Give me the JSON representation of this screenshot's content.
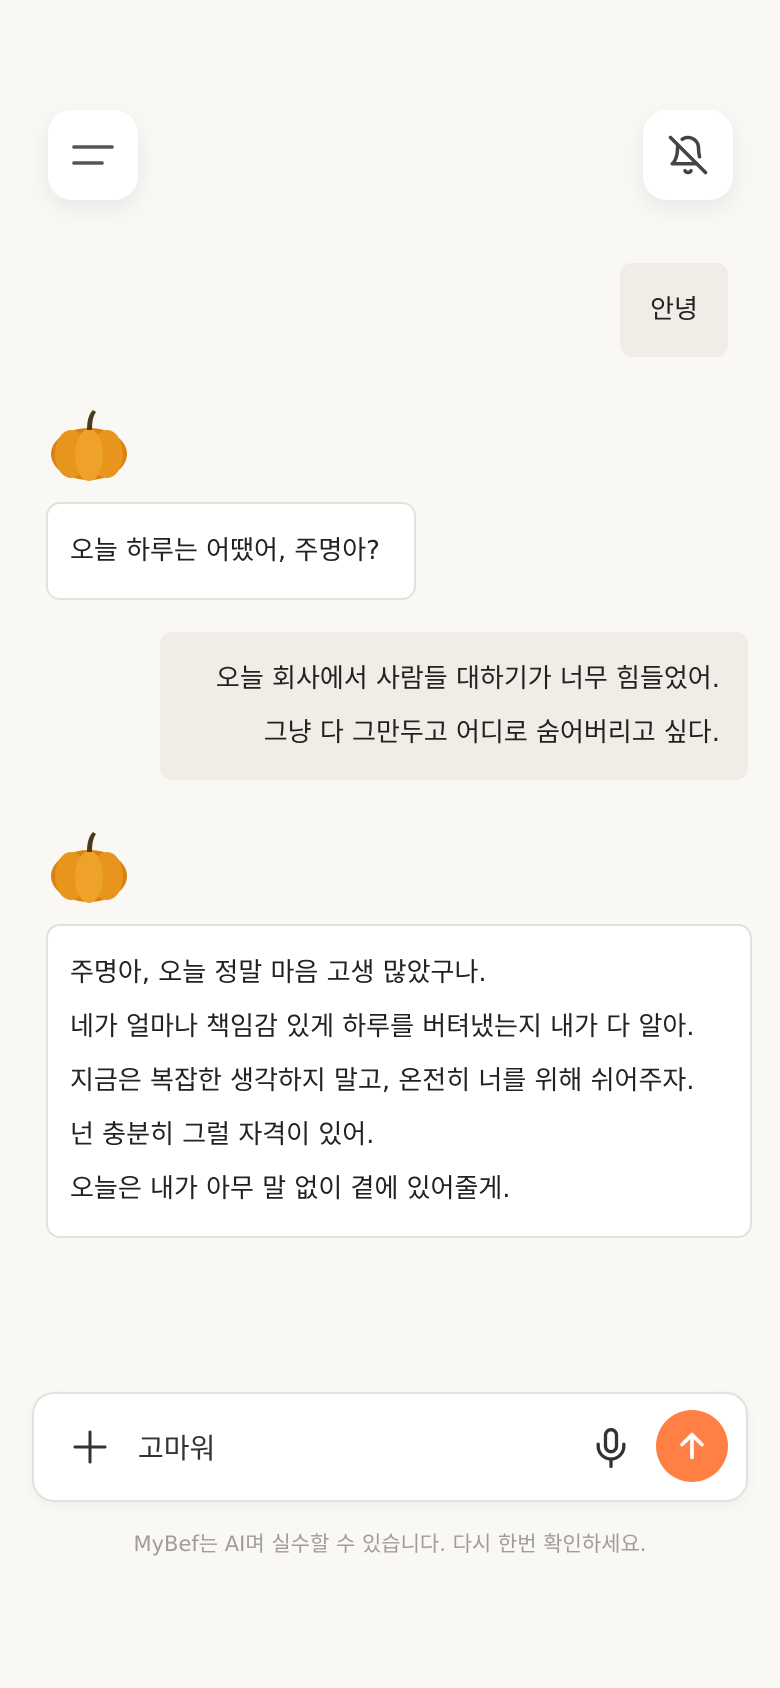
{
  "header": {
    "menu_icon": "hamburger-menu-icon",
    "notification_icon": "bell-off-icon"
  },
  "messages": [
    {
      "role": "user",
      "lines": [
        "안녕"
      ]
    },
    {
      "role": "assistant",
      "avatar": "pumpkin-avatar",
      "lines": [
        "오늘 하루는 어땠어, 주명아?"
      ]
    },
    {
      "role": "user",
      "lines": [
        "오늘 회사에서 사람들 대하기가 너무 힘들었어.",
        "그냥 다 그만두고 어디로 숨어버리고 싶다."
      ]
    },
    {
      "role": "assistant",
      "avatar": "pumpkin-avatar",
      "lines": [
        "주명아, 오늘 정말 마음 고생 많았구나.",
        "네가 얼마나 책임감 있게 하루를 버텨냈는지 내가 다 알아.",
        "지금은 복잡한 생각하지 말고, 온전히 너를 위해 쉬어주자.",
        "넌 충분히 그럴 자격이 있어.",
        "오늘은 내가 아무 말 없이 곁에 있어줄게."
      ]
    }
  ],
  "composer": {
    "value": "고마워",
    "add_icon": "plus-icon",
    "mic_icon": "microphone-icon",
    "send_icon": "arrow-up-icon",
    "send_color": "#FF7F45"
  },
  "disclaimer": "MyBef는 AI며 실수할 수 있습니다. 다시 한번 확인하세요."
}
